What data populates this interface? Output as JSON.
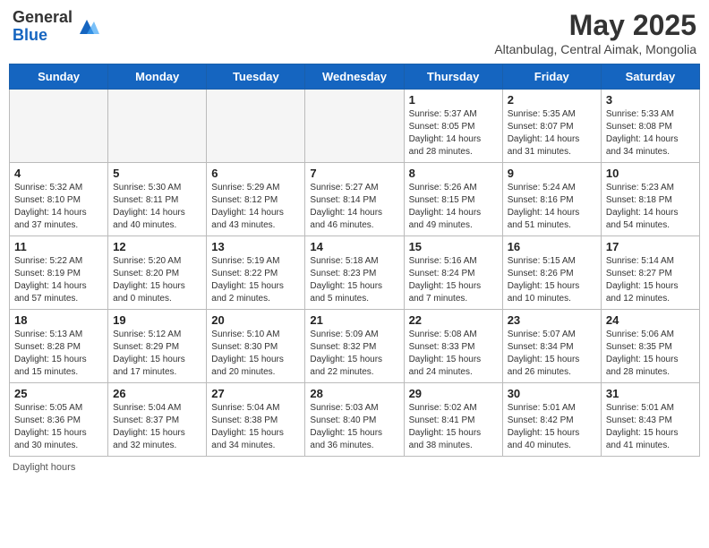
{
  "header": {
    "logo_general": "General",
    "logo_blue": "Blue",
    "month_year": "May 2025",
    "location": "Altanbulag, Central Aimak, Mongolia"
  },
  "days_of_week": [
    "Sunday",
    "Monday",
    "Tuesday",
    "Wednesday",
    "Thursday",
    "Friday",
    "Saturday"
  ],
  "weeks": [
    [
      {
        "day": "",
        "info": ""
      },
      {
        "day": "",
        "info": ""
      },
      {
        "day": "",
        "info": ""
      },
      {
        "day": "",
        "info": ""
      },
      {
        "day": "1",
        "info": "Sunrise: 5:37 AM\nSunset: 8:05 PM\nDaylight: 14 hours\nand 28 minutes."
      },
      {
        "day": "2",
        "info": "Sunrise: 5:35 AM\nSunset: 8:07 PM\nDaylight: 14 hours\nand 31 minutes."
      },
      {
        "day": "3",
        "info": "Sunrise: 5:33 AM\nSunset: 8:08 PM\nDaylight: 14 hours\nand 34 minutes."
      }
    ],
    [
      {
        "day": "4",
        "info": "Sunrise: 5:32 AM\nSunset: 8:10 PM\nDaylight: 14 hours\nand 37 minutes."
      },
      {
        "day": "5",
        "info": "Sunrise: 5:30 AM\nSunset: 8:11 PM\nDaylight: 14 hours\nand 40 minutes."
      },
      {
        "day": "6",
        "info": "Sunrise: 5:29 AM\nSunset: 8:12 PM\nDaylight: 14 hours\nand 43 minutes."
      },
      {
        "day": "7",
        "info": "Sunrise: 5:27 AM\nSunset: 8:14 PM\nDaylight: 14 hours\nand 46 minutes."
      },
      {
        "day": "8",
        "info": "Sunrise: 5:26 AM\nSunset: 8:15 PM\nDaylight: 14 hours\nand 49 minutes."
      },
      {
        "day": "9",
        "info": "Sunrise: 5:24 AM\nSunset: 8:16 PM\nDaylight: 14 hours\nand 51 minutes."
      },
      {
        "day": "10",
        "info": "Sunrise: 5:23 AM\nSunset: 8:18 PM\nDaylight: 14 hours\nand 54 minutes."
      }
    ],
    [
      {
        "day": "11",
        "info": "Sunrise: 5:22 AM\nSunset: 8:19 PM\nDaylight: 14 hours\nand 57 minutes."
      },
      {
        "day": "12",
        "info": "Sunrise: 5:20 AM\nSunset: 8:20 PM\nDaylight: 15 hours\nand 0 minutes."
      },
      {
        "day": "13",
        "info": "Sunrise: 5:19 AM\nSunset: 8:22 PM\nDaylight: 15 hours\nand 2 minutes."
      },
      {
        "day": "14",
        "info": "Sunrise: 5:18 AM\nSunset: 8:23 PM\nDaylight: 15 hours\nand 5 minutes."
      },
      {
        "day": "15",
        "info": "Sunrise: 5:16 AM\nSunset: 8:24 PM\nDaylight: 15 hours\nand 7 minutes."
      },
      {
        "day": "16",
        "info": "Sunrise: 5:15 AM\nSunset: 8:26 PM\nDaylight: 15 hours\nand 10 minutes."
      },
      {
        "day": "17",
        "info": "Sunrise: 5:14 AM\nSunset: 8:27 PM\nDaylight: 15 hours\nand 12 minutes."
      }
    ],
    [
      {
        "day": "18",
        "info": "Sunrise: 5:13 AM\nSunset: 8:28 PM\nDaylight: 15 hours\nand 15 minutes."
      },
      {
        "day": "19",
        "info": "Sunrise: 5:12 AM\nSunset: 8:29 PM\nDaylight: 15 hours\nand 17 minutes."
      },
      {
        "day": "20",
        "info": "Sunrise: 5:10 AM\nSunset: 8:30 PM\nDaylight: 15 hours\nand 20 minutes."
      },
      {
        "day": "21",
        "info": "Sunrise: 5:09 AM\nSunset: 8:32 PM\nDaylight: 15 hours\nand 22 minutes."
      },
      {
        "day": "22",
        "info": "Sunrise: 5:08 AM\nSunset: 8:33 PM\nDaylight: 15 hours\nand 24 minutes."
      },
      {
        "day": "23",
        "info": "Sunrise: 5:07 AM\nSunset: 8:34 PM\nDaylight: 15 hours\nand 26 minutes."
      },
      {
        "day": "24",
        "info": "Sunrise: 5:06 AM\nSunset: 8:35 PM\nDaylight: 15 hours\nand 28 minutes."
      }
    ],
    [
      {
        "day": "25",
        "info": "Sunrise: 5:05 AM\nSunset: 8:36 PM\nDaylight: 15 hours\nand 30 minutes."
      },
      {
        "day": "26",
        "info": "Sunrise: 5:04 AM\nSunset: 8:37 PM\nDaylight: 15 hours\nand 32 minutes."
      },
      {
        "day": "27",
        "info": "Sunrise: 5:04 AM\nSunset: 8:38 PM\nDaylight: 15 hours\nand 34 minutes."
      },
      {
        "day": "28",
        "info": "Sunrise: 5:03 AM\nSunset: 8:40 PM\nDaylight: 15 hours\nand 36 minutes."
      },
      {
        "day": "29",
        "info": "Sunrise: 5:02 AM\nSunset: 8:41 PM\nDaylight: 15 hours\nand 38 minutes."
      },
      {
        "day": "30",
        "info": "Sunrise: 5:01 AM\nSunset: 8:42 PM\nDaylight: 15 hours\nand 40 minutes."
      },
      {
        "day": "31",
        "info": "Sunrise: 5:01 AM\nSunset: 8:43 PM\nDaylight: 15 hours\nand 41 minutes."
      }
    ]
  ],
  "footer": {
    "daylight_hours": "Daylight hours"
  }
}
